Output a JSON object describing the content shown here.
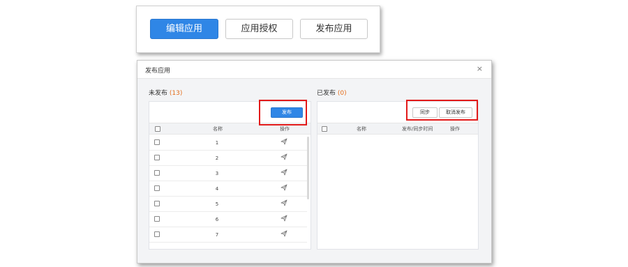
{
  "toolbar": {
    "edit_label": "编辑应用",
    "auth_label": "应用授权",
    "publish_label": "发布应用"
  },
  "dialog": {
    "title": "发布应用",
    "close_glyph": "×",
    "unpublished": {
      "label": "未发布",
      "count": "(13)",
      "publish_button": "发布",
      "columns": {
        "name": "名称",
        "op": "操作"
      },
      "rows": [
        "1",
        "2",
        "3",
        "4",
        "5",
        "6",
        "7"
      ]
    },
    "published": {
      "label": "已发布",
      "count": "(0)",
      "sync_button": "同步",
      "unpublish_button": "取消发布",
      "columns": {
        "name": "名称",
        "time": "发布/同步时间",
        "op": "操作"
      }
    }
  },
  "colors": {
    "primary": "#2f86e6",
    "highlight_box": "#e21a1a",
    "count_accent": "#e46d1b"
  },
  "icons": {
    "row_action": "paper-plane-icon",
    "close": "close-icon"
  }
}
